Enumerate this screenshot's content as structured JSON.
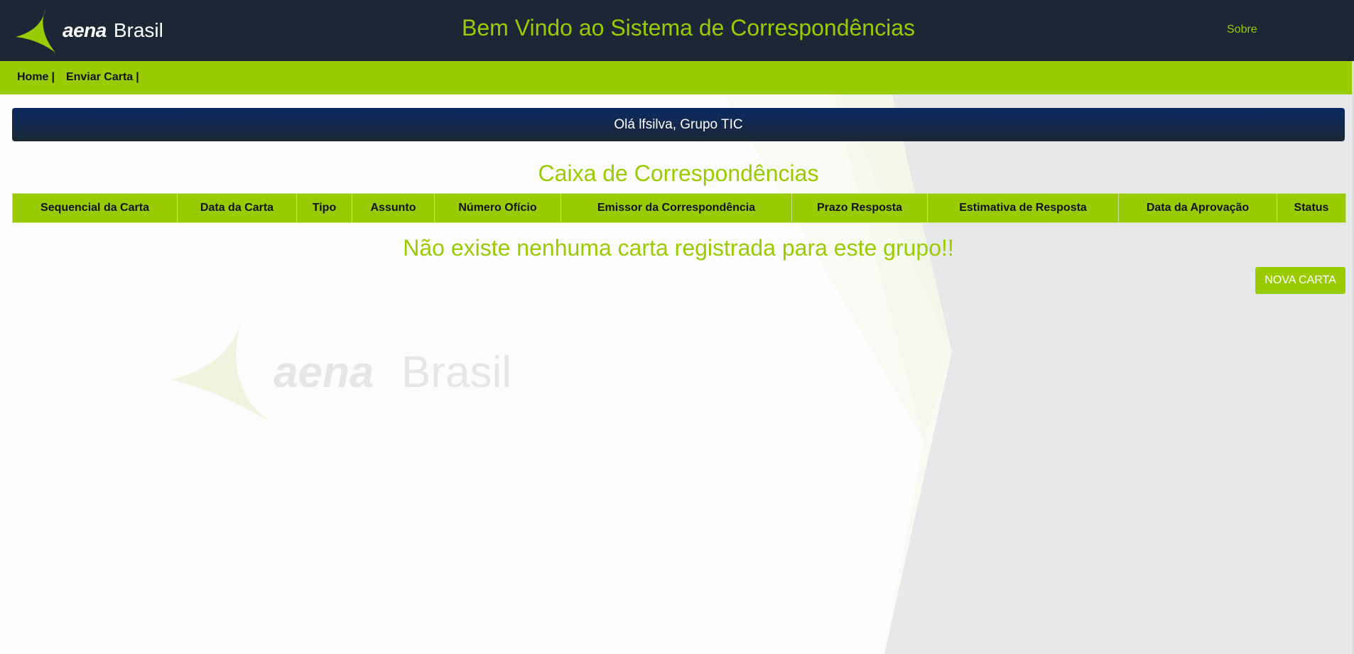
{
  "header": {
    "logo": {
      "brand": "aena",
      "country": "Brasil",
      "icon": "aena-swoosh-icon"
    },
    "title": "Bem Vindo ao Sistema de Correspondências",
    "about_label": "Sobre"
  },
  "nav": {
    "items": [
      {
        "label": "Home",
        "separator": "|"
      },
      {
        "label": "Enviar Carta",
        "separator": "|"
      }
    ]
  },
  "greeting": "Olá lfsilva, Grupo TIC",
  "inbox": {
    "title": "Caixa de Correspondências",
    "columns": [
      "Sequencial da Carta",
      "Data da Carta",
      "Tipo",
      "Assunto",
      "Número Ofício",
      "Emissor da Correspondência",
      "Prazo Resposta",
      "Estimativa de Resposta",
      "Data da Aprovação",
      "Status"
    ],
    "rows": [],
    "empty_message": "Não existe nenhuma carta registrada para este grupo!!",
    "new_button_label": "NOVA CARTA"
  },
  "watermark": {
    "brand": "aena",
    "country": "Brasil"
  },
  "colors": {
    "header_bg": "#1b2735",
    "accent": "#99cc00",
    "greeting_bg": "#0b2a63",
    "page_bg": "#fcfcfc"
  }
}
